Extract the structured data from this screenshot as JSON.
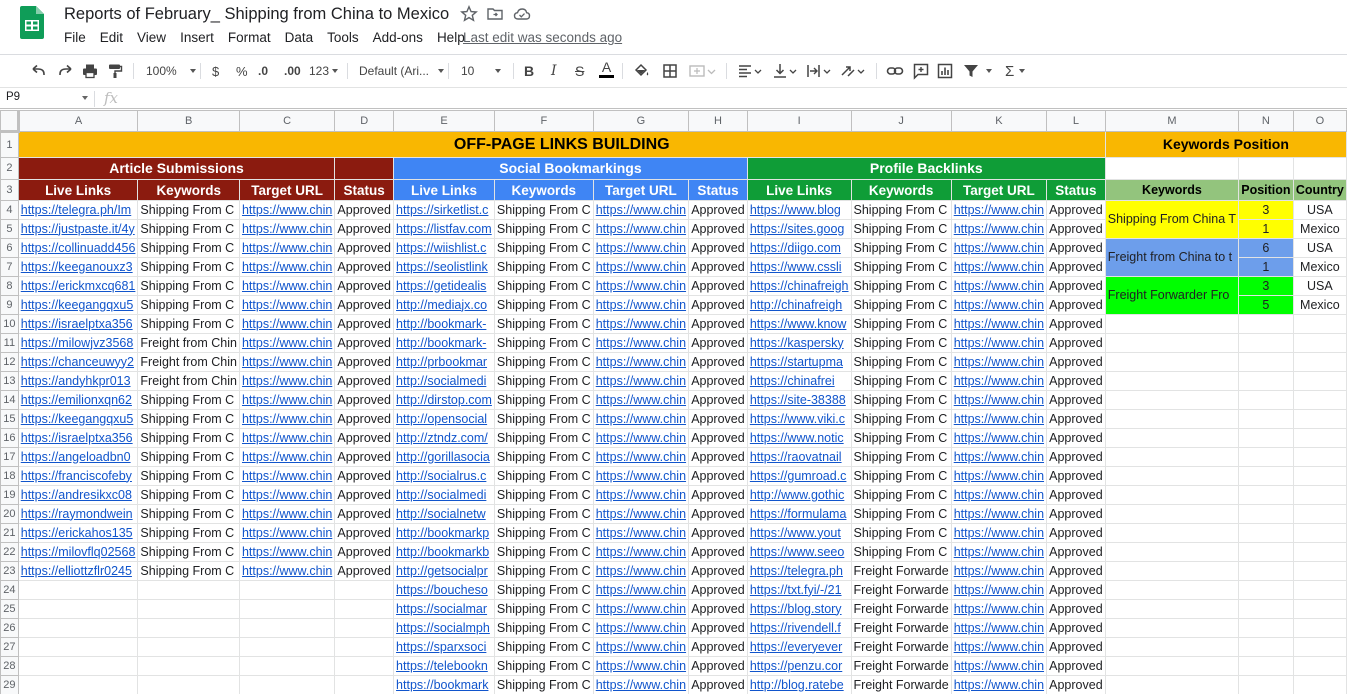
{
  "app": {
    "title": "Reports of February_ Shipping from China to Mexico",
    "last_edit": "Last edit was seconds ago",
    "menu": [
      "File",
      "Edit",
      "View",
      "Insert",
      "Format",
      "Data",
      "Tools",
      "Add-ons",
      "Help"
    ]
  },
  "toolbar": {
    "zoom": "100%",
    "currency": "$",
    "percent": "%",
    "dec_decrease": ".0",
    "dec_increase": ".00",
    "more_formats": "123",
    "font": "Default (Ari...",
    "font_size": "10",
    "bold": "B",
    "italic": "I",
    "strike": "S",
    "text_color": "A",
    "sum": "Σ"
  },
  "formula_bar": {
    "cell_ref": "P9",
    "fx": "fx"
  },
  "columns": [
    "A",
    "B",
    "C",
    "D",
    "E",
    "F",
    "G",
    "H",
    "I",
    "J",
    "K",
    "L",
    "M",
    "N",
    "O"
  ],
  "sheet": {
    "banner": "OFF-PAGE LINKS BUILDING",
    "sections": {
      "article": "Article Submissions",
      "social": "Social Bookmarkings",
      "profile": "Profile Backlinks"
    },
    "subheaders": [
      "Live Links",
      "Keywords",
      "Target URL",
      "Status"
    ],
    "rows": [
      {
        "a": "https://telegra.ph/Im",
        "b": "Shipping From C",
        "c": "https://www.chin",
        "d": "Approved",
        "e": "https://sirketlist.c",
        "f": "Shipping From C",
        "g": "https://www.chin",
        "h": "Approved",
        "i": "https://www.blog",
        "j": "Shipping From C",
        "k": "https://www.chin",
        "l": "Approved"
      },
      {
        "a": "https://justpaste.it/4y",
        "b": "Shipping From C",
        "c": "https://www.chin",
        "d": "Approved",
        "e": "https://listfav.com",
        "f": "Shipping From C",
        "g": "https://www.chin",
        "h": "Approved",
        "i": "https://sites.goog",
        "j": "Shipping From C",
        "k": "https://www.chin",
        "l": "Approved"
      },
      {
        "a": "https://collinuadd456",
        "b": "Shipping From C",
        "c": "https://www.chin",
        "d": "Approved",
        "e": "https://wiishlist.c",
        "f": "Shipping From C",
        "g": "https://www.chin",
        "h": "Approved",
        "i": "https://diigo.com",
        "j": "Shipping From C",
        "k": "https://www.chin",
        "l": "Approved"
      },
      {
        "a": "https://keeganouxz3",
        "b": "Shipping From C",
        "c": "https://www.chin",
        "d": "Approved",
        "e": "https://seolistlink",
        "f": "Shipping From C",
        "g": "https://www.chin",
        "h": "Approved",
        "i": "https://www.cssli",
        "j": "Shipping From C",
        "k": "https://www.chin",
        "l": "Approved"
      },
      {
        "a": "https://erickmxcq681",
        "b": "Shipping From C",
        "c": "https://www.chin",
        "d": "Approved",
        "e": "https://getidealis",
        "f": "Shipping From C",
        "g": "https://www.chin",
        "h": "Approved",
        "i": "https://chinafreigh",
        "j": "Shipping From C",
        "k": "https://www.chin",
        "l": "Approved"
      },
      {
        "a": "https://keegangqxu5",
        "b": "Shipping From C",
        "c": "https://www.chin",
        "d": "Approved",
        "e": "http://mediajx.co",
        "f": "Shipping From C",
        "g": "https://www.chin",
        "h": "Approved",
        "i": "http://chinafreigh",
        "j": "Shipping From C",
        "k": "https://www.chin",
        "l": "Approved"
      },
      {
        "a": "https://israelptxa356",
        "b": "Shipping From C",
        "c": "https://www.chin",
        "d": "Approved",
        "e": "http://bookmark-",
        "f": "Shipping From C",
        "g": "https://www.chin",
        "h": "Approved",
        "i": "https://www.know",
        "j": "Shipping From C",
        "k": "https://www.chin",
        "l": "Approved"
      },
      {
        "a": "https://milowjvz3568",
        "b": "Freight from Chin",
        "c": "https://www.chin",
        "d": "Approved",
        "e": "http://bookmark-",
        "f": "Shipping From C",
        "g": "https://www.chin",
        "h": "Approved",
        "i": "https://kaspersky",
        "j": "Shipping From C",
        "k": "https://www.chin",
        "l": "Approved"
      },
      {
        "a": "https://chanceuwyy2",
        "b": "Freight from Chin",
        "c": "https://www.chin",
        "d": "Approved",
        "e": "http://prbookmar",
        "f": "Shipping From C",
        "g": "https://www.chin",
        "h": "Approved",
        "i": "https://startupma",
        "j": "Shipping From C",
        "k": "https://www.chin",
        "l": "Approved"
      },
      {
        "a": "https://andyhkpr013",
        "b": "Freight from Chin",
        "c": "https://www.chin",
        "d": "Approved",
        "e": "http://socialmedi",
        "f": "Shipping From C",
        "g": "https://www.chin",
        "h": "Approved",
        "i": "https://chinafrei",
        "j": "Shipping From C",
        "k": "https://www.chin",
        "l": "Approved"
      },
      {
        "a": "https://emilionxqn62",
        "b": "Shipping From C",
        "c": "https://www.chin",
        "d": "Approved",
        "e": "http://dirstop.com",
        "f": "Shipping From C",
        "g": "https://www.chin",
        "h": "Approved",
        "i": "https://site-38388",
        "j": "Shipping From C",
        "k": "https://www.chin",
        "l": "Approved"
      },
      {
        "a": "https://keegangqxu5",
        "b": "Shipping From C",
        "c": "https://www.chin",
        "d": "Approved",
        "e": "http://opensocial",
        "f": "Shipping From C",
        "g": "https://www.chin",
        "h": "Approved",
        "i": "https://www.viki.c",
        "j": "Shipping From C",
        "k": "https://www.chin",
        "l": "Approved"
      },
      {
        "a": "https://israelptxa356",
        "b": "Shipping From C",
        "c": "https://www.chin",
        "d": "Approved",
        "e": "http://ztndz.com/",
        "f": "Shipping From C",
        "g": "https://www.chin",
        "h": "Approved",
        "i": "https://www.notic",
        "j": "Shipping From C",
        "k": "https://www.chin",
        "l": "Approved"
      },
      {
        "a": "https://angeloadbn0",
        "b": "Shipping From C",
        "c": "https://www.chin",
        "d": "Approved",
        "e": "http://gorillasocia",
        "f": "Shipping From C",
        "g": "https://www.chin",
        "h": "Approved",
        "i": "https://raovatnail",
        "j": "Shipping From C",
        "k": "https://www.chin",
        "l": "Approved"
      },
      {
        "a": "https://franciscofeby",
        "b": "Shipping From C",
        "c": "https://www.chin",
        "d": "Approved",
        "e": "http://socialrus.c",
        "f": "Shipping From C",
        "g": "https://www.chin",
        "h": "Approved",
        "i": "https://gumroad.c",
        "j": "Shipping From C",
        "k": "https://www.chin",
        "l": "Approved"
      },
      {
        "a": "https://andresikxc08",
        "b": "Shipping From C",
        "c": "https://www.chin",
        "d": "Approved",
        "e": "http://socialmedi",
        "f": "Shipping From C",
        "g": "https://www.chin",
        "h": "Approved",
        "i": "http://www.gothic",
        "j": "Shipping From C",
        "k": "https://www.chin",
        "l": "Approved"
      },
      {
        "a": "https://raymondwein",
        "b": "Shipping From C",
        "c": "https://www.chin",
        "d": "Approved",
        "e": "http://socialnetw",
        "f": "Shipping From C",
        "g": "https://www.chin",
        "h": "Approved",
        "i": "https://formulama",
        "j": "Shipping From C",
        "k": "https://www.chin",
        "l": "Approved"
      },
      {
        "a": "https://erickahos135",
        "b": "Shipping From C",
        "c": "https://www.chin",
        "d": "Approved",
        "e": "http://bookmarkp",
        "f": "Shipping From C",
        "g": "https://www.chin",
        "h": "Approved",
        "i": "https://www.yout",
        "j": "Shipping From C",
        "k": "https://www.chin",
        "l": "Approved"
      },
      {
        "a": "https://milovflq02568",
        "b": "Shipping From C",
        "c": "https://www.chin",
        "d": "Approved",
        "e": "http://bookmarkb",
        "f": "Shipping From C",
        "g": "https://www.chin",
        "h": "Approved",
        "i": "https://www.seeo",
        "j": "Shipping From C",
        "k": "https://www.chin",
        "l": "Approved"
      },
      {
        "a": "https://elliottzflr0245",
        "b": "Shipping From C",
        "c": "https://www.chin",
        "d": "Approved",
        "e": "http://getsocialpr",
        "f": "Shipping From C",
        "g": "https://www.chin",
        "h": "Approved",
        "i": "https://telegra.ph",
        "j": "Freight Forwarde",
        "k": "https://www.chin",
        "l": "Approved"
      },
      {
        "a": "",
        "b": "",
        "c": "",
        "d": "",
        "e": "https://boucheso",
        "f": "Shipping From C",
        "g": "https://www.chin",
        "h": "Approved",
        "i": "https://txt.fyi/-/21",
        "j": "Freight Forwarde",
        "k": "https://www.chin",
        "l": "Approved"
      },
      {
        "a": "",
        "b": "",
        "c": "",
        "d": "",
        "e": "https://socialmar",
        "f": "Shipping From C",
        "g": "https://www.chin",
        "h": "Approved",
        "i": "https://blog.story",
        "j": "Freight Forwarde",
        "k": "https://www.chin",
        "l": "Approved"
      },
      {
        "a": "",
        "b": "",
        "c": "",
        "d": "",
        "e": "https://socialmph",
        "f": "Shipping From C",
        "g": "https://www.chin",
        "h": "Approved",
        "i": "https://rivendell.f",
        "j": "Freight Forwarde",
        "k": "https://www.chin",
        "l": "Approved"
      },
      {
        "a": "",
        "b": "",
        "c": "",
        "d": "",
        "e": "https://sparxsoci",
        "f": "Shipping From C",
        "g": "https://www.chin",
        "h": "Approved",
        "i": "https://everyever",
        "j": "Freight Forwarde",
        "k": "https://www.chin",
        "l": "Approved"
      },
      {
        "a": "",
        "b": "",
        "c": "",
        "d": "",
        "e": "https://telebookn",
        "f": "Shipping From C",
        "g": "https://www.chin",
        "h": "Approved",
        "i": "https://penzu.cor",
        "j": "Freight Forwarde",
        "k": "https://www.chin",
        "l": "Approved"
      },
      {
        "a": "",
        "b": "",
        "c": "",
        "d": "",
        "e": "https://bookmark",
        "f": "Shipping From C",
        "g": "https://www.chin",
        "h": "Approved",
        "i": "http://blog.ratebe",
        "j": "Freight Forwarde",
        "k": "https://www.chin",
        "l": "Approved"
      }
    ],
    "keywords_position": {
      "title": "Keywords Position",
      "headers": [
        "Keywords",
        "Position",
        "Country"
      ],
      "groups": [
        {
          "keyword": "Shipping From China T",
          "color": "#ffff00",
          "entries": [
            {
              "position": "3",
              "country": "USA"
            },
            {
              "position": "1",
              "country": "Mexico"
            }
          ]
        },
        {
          "keyword": "Freight from China to t",
          "color": "#6d9eeb",
          "entries": [
            {
              "position": "6",
              "country": "USA"
            },
            {
              "position": "1",
              "country": "Mexico"
            }
          ]
        },
        {
          "keyword": "Freight Forwarder Fro",
          "color": "#00ff00",
          "entries": [
            {
              "position": "3",
              "country": "USA"
            },
            {
              "position": "5",
              "country": "Mexico"
            }
          ]
        }
      ]
    }
  },
  "colors": {
    "banner": "#f9b701",
    "article": "#8b1b0f",
    "social": "#3f85f4",
    "profile": "#0f9d37",
    "kp_header": "#93c47d",
    "link": "#1155cc"
  }
}
